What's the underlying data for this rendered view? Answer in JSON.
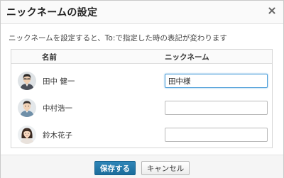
{
  "dialog": {
    "title": "ニックネームの設定",
    "close_icon": "close-icon",
    "description": "ニックネームを設定すると、To:で指定した時の表記が変わります"
  },
  "table": {
    "headers": {
      "name": "名前",
      "nickname": "ニックネーム"
    },
    "rows": [
      {
        "name": "田中 健一",
        "nickname": "田中様",
        "avatar_icon": "avatar-man-glasses"
      },
      {
        "name": "中村浩一",
        "nickname": "",
        "avatar_icon": "avatar-man-short-hair"
      },
      {
        "name": "鈴木花子",
        "nickname": "",
        "avatar_icon": "avatar-woman"
      }
    ]
  },
  "footer": {
    "save_label": "保存する",
    "cancel_label": "キャンセル"
  },
  "colors": {
    "primary_button": "#1f73a6",
    "focus_border": "#4c9ed9"
  }
}
